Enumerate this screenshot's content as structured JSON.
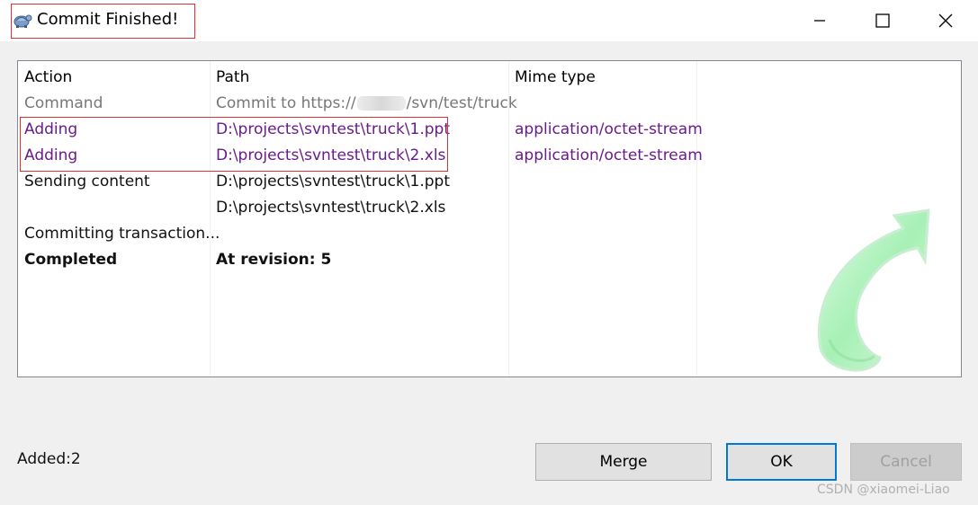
{
  "window": {
    "title": "Commit Finished!",
    "controls": {
      "minimize": "minimize",
      "maximize": "maximize",
      "close": "close"
    }
  },
  "list": {
    "columns": [
      "Action",
      "Path",
      "Mime type"
    ],
    "rows": [
      {
        "action": "Command",
        "path_prefix": "Commit to https://",
        "path_suffix": "/svn/test/truck",
        "mime": "",
        "style": "gray"
      },
      {
        "action": "Adding",
        "path": "D:\\projects\\svntest\\truck\\1.ppt",
        "mime": "application/octet-stream",
        "style": "purple"
      },
      {
        "action": "Adding",
        "path": "D:\\projects\\svntest\\truck\\2.xls",
        "mime": "application/octet-stream",
        "style": "purple"
      },
      {
        "action": "Sending content",
        "path": "D:\\projects\\svntest\\truck\\1.ppt",
        "mime": "",
        "style": "black"
      },
      {
        "action": "",
        "path": "D:\\projects\\svntest\\truck\\2.xls",
        "mime": "",
        "style": "black"
      },
      {
        "action": "Committing transaction...",
        "path": "",
        "mime": "",
        "style": "black"
      },
      {
        "action": "Completed",
        "path": "At revision: 5",
        "mime": "",
        "style": "bold"
      }
    ]
  },
  "status": {
    "text": "Added:2"
  },
  "buttons": {
    "merge": "Merge",
    "ok": "OK",
    "cancel": "Cancel"
  },
  "watermark": "CSDN @xiaomei-Liao",
  "colors": {
    "accent": "#0078d7",
    "highlight_box": "#e03030",
    "adding_text": "#6a1b8a",
    "arrow_fill": "#9ff0b0"
  }
}
